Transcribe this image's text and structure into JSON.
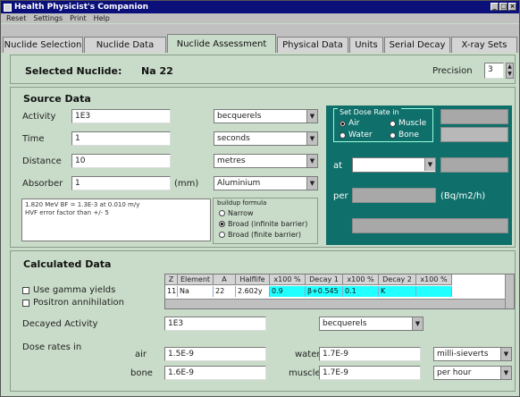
{
  "window": {
    "title": "Health Physicist's Companion"
  },
  "menu": [
    "Reset",
    "Settings",
    "Print",
    "Help"
  ],
  "tabs": [
    "Nuclide Selection",
    "Nuclide Data",
    "Nuclide Assessment",
    "Physical Data",
    "Units",
    "Serial Decay",
    "X-ray Sets"
  ],
  "header": {
    "selected_label": "Selected Nuclide:",
    "selected_value": "Na 22",
    "precision_label": "Precision",
    "precision_value": "3"
  },
  "source": {
    "title": "Source Data",
    "activity_label": "Activity",
    "activity_value": "1E3",
    "activity_unit": "becquerels",
    "time_label": "Time",
    "time_value": "1",
    "time_unit": "seconds",
    "distance_label": "Distance",
    "distance_value": "10",
    "distance_unit": "metres",
    "absorber_label": "Absorber",
    "absorber_value": "1",
    "absorber_unit": "(mm)",
    "absorber_material": "Aluminium",
    "memo": [
      "1.820 MeV BF = 1.3E-3 at 0.010 m/y",
      "HVF error factor than +/- 5"
    ],
    "buildup_title": "buildup formula",
    "buildup_options": [
      "Narrow",
      "Broad (infinite barrier)",
      "Broad (finite barrier)"
    ],
    "buildup_selected": 1
  },
  "dose_panel": {
    "group_title": "Set Dose Rate in",
    "options": [
      "Air",
      "Muscle",
      "Water",
      "Bone"
    ],
    "selected": 0,
    "at_label": "at",
    "per_label": "per",
    "unit_label": "(Bq/m2/h)"
  },
  "calc": {
    "title": "Calculated Data",
    "use_gamma": "Use gamma yields",
    "positron": "Positron annihilation",
    "grid_headers": [
      "Z",
      "Element",
      "A",
      "Halflife",
      "x100 %",
      "Decay 1",
      "x100 %",
      "Decay 2",
      "x100 %"
    ],
    "grid_row": [
      "11",
      "Na",
      "22",
      "2.602y",
      "0.9",
      "β+0.545",
      "0.1",
      "K",
      ""
    ],
    "decayed_label": "Decayed Activity",
    "decayed_value": "1E3",
    "decayed_unit": "becquerels",
    "dose_label": "Dose rates in",
    "air_label": "air",
    "air_value": "1.5E-9",
    "water_label": "water",
    "water_value": "1.7E-9",
    "bone_label": "bone",
    "bone_value": "1.6E-9",
    "muscle_label": "muscle",
    "muscle_value": "1.7E-9",
    "unit1": "milli-sieverts",
    "unit2": "per hour"
  }
}
